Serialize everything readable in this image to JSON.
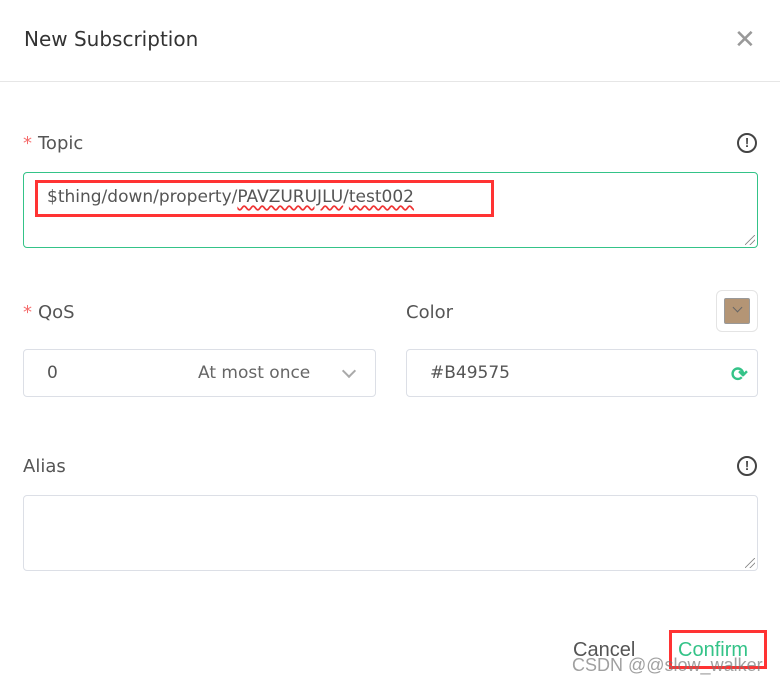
{
  "dialog": {
    "title": "New Subscription",
    "close_icon": "close-icon"
  },
  "topic": {
    "label": "Topic",
    "required_mark": "*",
    "value_plain": "$thing/down/property/",
    "value_seg1": "PAVZURUJLU",
    "value_sep": "/",
    "value_seg2": "test002",
    "info_icon": "info-icon"
  },
  "qos": {
    "label": "QoS",
    "required_mark": "*",
    "value": "0",
    "description": "At most once"
  },
  "color": {
    "label": "Color",
    "value": "#B49575",
    "swatch_color": "#B49575",
    "refresh_icon": "refresh-icon"
  },
  "alias": {
    "label": "Alias",
    "value": "",
    "info_icon": "info-icon"
  },
  "footer": {
    "cancel": "Cancel",
    "confirm": "Confirm"
  },
  "watermark": "CSDN @@slow_walker",
  "colors": {
    "accent": "#34c388",
    "required": "#f56c6c",
    "highlight": "#ff3333"
  }
}
